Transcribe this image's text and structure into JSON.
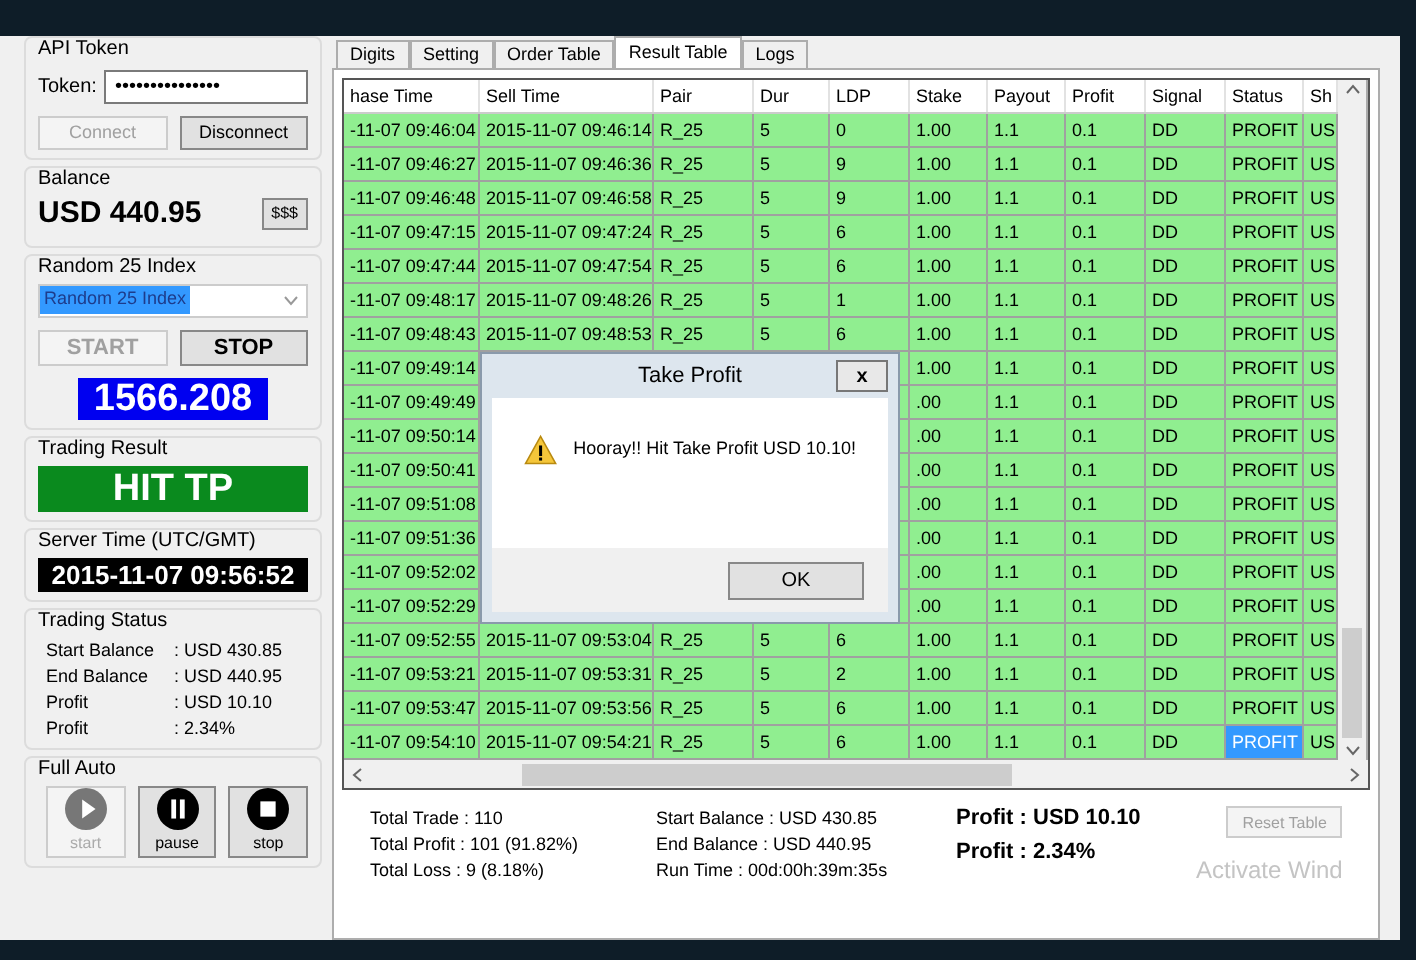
{
  "api_token": {
    "title": "API Token",
    "token_label": "Token:",
    "token_value": "•••••••••••••••",
    "connect": {
      "label": "Connect",
      "disabled": true
    },
    "disconnect": {
      "label": "Disconnect",
      "disabled": false
    }
  },
  "balance": {
    "title": "Balance",
    "value": "USD 440.95",
    "button": "$$$"
  },
  "index": {
    "title": "Random 25 Index",
    "selected_option": "Random 25 Index",
    "start": {
      "label": "START",
      "disabled": true
    },
    "stop": {
      "label": "STOP",
      "disabled": false
    },
    "price": "1566.208"
  },
  "trading_result": {
    "title": "Trading Result",
    "value": "HIT TP"
  },
  "server_time": {
    "title": "Server Time (UTC/GMT)",
    "value": "2015-11-07 09:56:52"
  },
  "trading_status": {
    "title": "Trading Status",
    "rows": [
      {
        "label": "Start Balance",
        "value": ": USD 430.85"
      },
      {
        "label": "End Balance",
        "value": ": USD 440.95"
      },
      {
        "label": "Profit",
        "value": ": USD 10.10"
      },
      {
        "label": "Profit",
        "value": ": 2.34%"
      }
    ]
  },
  "full_auto": {
    "title": "Full Auto",
    "buttons": [
      {
        "kind": "play",
        "label": "start",
        "disabled": true
      },
      {
        "kind": "pause",
        "label": "pause",
        "disabled": false
      },
      {
        "kind": "stop",
        "label": "stop",
        "disabled": false
      }
    ]
  },
  "tabs": [
    {
      "label": "Digits",
      "selected": false
    },
    {
      "label": "Setting",
      "selected": false
    },
    {
      "label": "Order Table",
      "selected": false
    },
    {
      "label": "Result Table",
      "selected": true
    },
    {
      "label": "Logs",
      "selected": false
    }
  ],
  "table": {
    "columns": [
      "hase Time",
      "Sell Time",
      "Pair",
      "Dur",
      "LDP",
      "Stake",
      "Payout",
      "Profit",
      "Signal",
      "Status",
      "Sh"
    ],
    "rows": [
      {
        "selected": false,
        "cells": [
          "-11-07 09:46:04",
          "2015-11-07 09:46:14",
          "R_25",
          "5",
          "0",
          "1.00",
          "1.1",
          "0.1",
          "DD",
          "PROFIT",
          "US"
        ]
      },
      {
        "selected": false,
        "cells": [
          "-11-07 09:46:27",
          "2015-11-07 09:46:36",
          "R_25",
          "5",
          "9",
          "1.00",
          "1.1",
          "0.1",
          "DD",
          "PROFIT",
          "US"
        ]
      },
      {
        "selected": false,
        "cells": [
          "-11-07 09:46:48",
          "2015-11-07 09:46:58",
          "R_25",
          "5",
          "9",
          "1.00",
          "1.1",
          "0.1",
          "DD",
          "PROFIT",
          "US"
        ]
      },
      {
        "selected": false,
        "cells": [
          "-11-07 09:47:15",
          "2015-11-07 09:47:24",
          "R_25",
          "5",
          "6",
          "1.00",
          "1.1",
          "0.1",
          "DD",
          "PROFIT",
          "US"
        ]
      },
      {
        "selected": false,
        "cells": [
          "-11-07 09:47:44",
          "2015-11-07 09:47:54",
          "R_25",
          "5",
          "6",
          "1.00",
          "1.1",
          "0.1",
          "DD",
          "PROFIT",
          "US"
        ]
      },
      {
        "selected": false,
        "cells": [
          "-11-07 09:48:17",
          "2015-11-07 09:48:26",
          "R_25",
          "5",
          "1",
          "1.00",
          "1.1",
          "0.1",
          "DD",
          "PROFIT",
          "US"
        ]
      },
      {
        "selected": false,
        "cells": [
          "-11-07 09:48:43",
          "2015-11-07 09:48:53",
          "R_25",
          "5",
          "6",
          "1.00",
          "1.1",
          "0.1",
          "DD",
          "PROFIT",
          "US"
        ]
      },
      {
        "selected": false,
        "cells": [
          "-11-07 09:49:14",
          null,
          null,
          null,
          null,
          "1.00",
          "1.1",
          "0.1",
          "DD",
          "PROFIT",
          "US"
        ]
      },
      {
        "selected": false,
        "cells": [
          "-11-07 09:49:49",
          null,
          null,
          null,
          null,
          ".00",
          "1.1",
          "0.1",
          "DD",
          "PROFIT",
          "US"
        ]
      },
      {
        "selected": false,
        "cells": [
          "-11-07 09:50:14",
          null,
          null,
          null,
          null,
          ".00",
          "1.1",
          "0.1",
          "DD",
          "PROFIT",
          "US"
        ]
      },
      {
        "selected": false,
        "cells": [
          "-11-07 09:50:41",
          null,
          null,
          null,
          null,
          ".00",
          "1.1",
          "0.1",
          "DD",
          "PROFIT",
          "US"
        ]
      },
      {
        "selected": false,
        "cells": [
          "-11-07 09:51:08",
          null,
          null,
          null,
          null,
          ".00",
          "1.1",
          "0.1",
          "DD",
          "PROFIT",
          "US"
        ]
      },
      {
        "selected": false,
        "cells": [
          "-11-07 09:51:36",
          null,
          null,
          null,
          null,
          ".00",
          "1.1",
          "0.1",
          "DD",
          "PROFIT",
          "US"
        ]
      },
      {
        "selected": false,
        "cells": [
          "-11-07 09:52:02",
          null,
          null,
          null,
          null,
          ".00",
          "1.1",
          "0.1",
          "DD",
          "PROFIT",
          "US"
        ]
      },
      {
        "selected": false,
        "cells": [
          "-11-07 09:52:29",
          null,
          null,
          null,
          null,
          ".00",
          "1.1",
          "0.1",
          "DD",
          "PROFIT",
          "US"
        ]
      },
      {
        "selected": false,
        "cells": [
          "-11-07 09:52:55",
          "2015-11-07 09:53:04",
          "R_25",
          "5",
          "6",
          "1.00",
          "1.1",
          "0.1",
          "DD",
          "PROFIT",
          "US"
        ]
      },
      {
        "selected": false,
        "cells": [
          "-11-07 09:53:21",
          "2015-11-07 09:53:31",
          "R_25",
          "5",
          "2",
          "1.00",
          "1.1",
          "0.1",
          "DD",
          "PROFIT",
          "US"
        ]
      },
      {
        "selected": false,
        "cells": [
          "-11-07 09:53:47",
          "2015-11-07 09:53:56",
          "R_25",
          "5",
          "6",
          "1.00",
          "1.1",
          "0.1",
          "DD",
          "PROFIT",
          "US"
        ]
      },
      {
        "selected": true,
        "cells": [
          "-11-07 09:54:10",
          "2015-11-07 09:54:21",
          "R_25",
          "5",
          "6",
          "1.00",
          "1.1",
          "0.1",
          "DD",
          "PROFIT",
          "US"
        ]
      }
    ]
  },
  "summary": {
    "left": [
      "Total Trade : 110",
      "Total Profit : 101 (91.82%)",
      "Total Loss : 9 (8.18%)"
    ],
    "middle": [
      "Start Balance : USD 430.85",
      "End Balance : USD 440.95",
      "Run Time : 00d:00h:39m:35s"
    ],
    "profit": [
      "Profit : USD 10.10",
      "Profit : 2.34%"
    ],
    "reset_button": {
      "label": "Reset Table",
      "disabled": true
    }
  },
  "dialog": {
    "title": "Take Profit",
    "close": "x",
    "message": "Hooray!! Hit Take Profit USD 10.10!",
    "ok": "OK"
  },
  "os_notice": "Activate Wind"
}
